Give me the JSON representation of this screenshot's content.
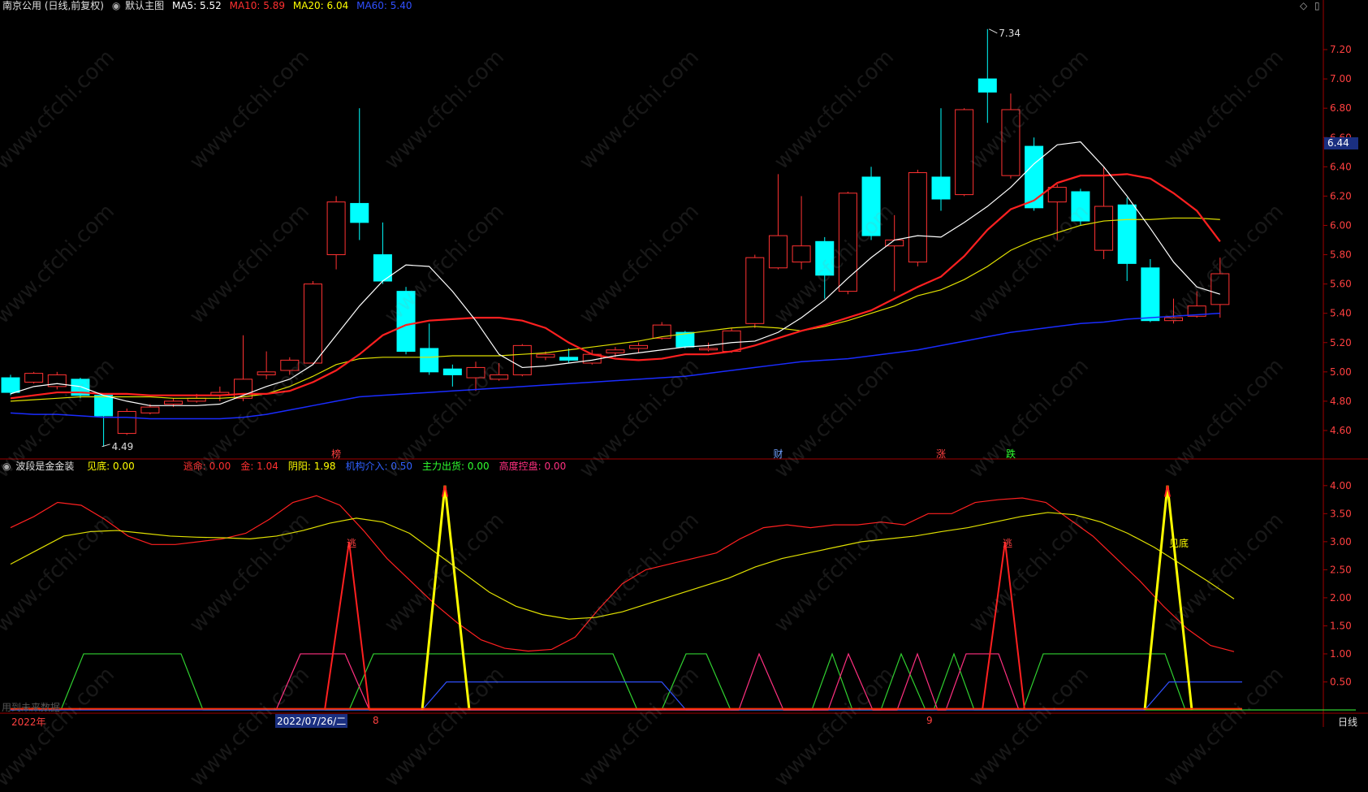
{
  "main_header": {
    "title": "南京公用 (日线,前复权)",
    "template": "默认主图",
    "ma5": "MA5: 5.52",
    "ma10": "MA10: 5.89",
    "ma20": "MA20: 6.04",
    "ma60": "MA60: 5.40"
  },
  "sub_header": {
    "title": "波段是金金装",
    "items": [
      {
        "text": "见底: 0.00",
        "color": "#ffff00"
      },
      {
        "text": "逃命: 0.00",
        "color": "#ff3030"
      },
      {
        "text": "金: 1.04",
        "color": "#ff3030"
      },
      {
        "text": "阴阳: 1.98",
        "color": "#ffff00"
      },
      {
        "text": "机构介入: 0.50",
        "color": "#3060ff"
      },
      {
        "text": "主力出货: 0.00",
        "color": "#30ff30"
      },
      {
        "text": "高度控盘: 0.00",
        "color": "#ff3080"
      }
    ]
  },
  "price_axis": [
    "7.20",
    "7.00",
    "6.80",
    "6.60",
    "6.40",
    "6.20",
    "6.00",
    "5.80",
    "5.60",
    "5.40",
    "5.20",
    "5.00",
    "4.80",
    "4.60"
  ],
  "current_price": "6.44",
  "high_label": "7.34",
  "low_label": "4.49",
  "event_markers": [
    "榜",
    "财",
    "涨",
    "跌"
  ],
  "sub_axis": [
    "4.00",
    "3.50",
    "3.00",
    "2.50",
    "2.00",
    "1.50",
    "1.00",
    "0.50"
  ],
  "sub_annotations": {
    "escape": "逃",
    "bottom": "见底"
  },
  "date_bar": {
    "year": "2022年",
    "cursor_date": "2022/07/26/二",
    "month8": "8",
    "month9": "9",
    "period": "日线"
  },
  "watermark": "www.cfchi.com",
  "footer_note": "用到未来数据",
  "colors": {
    "bg": "#000000",
    "up": "#ff3232",
    "down": "#00ffff",
    "ma5": "#ffffff",
    "ma10": "#ff2020",
    "ma20": "#e0e000",
    "ma60": "#1a2cff",
    "axis": "#a00000"
  },
  "chart_data": {
    "type": "candlestick",
    "ylim": [
      4.5,
      7.35
    ],
    "candles": [
      [
        4.96,
        4.86,
        4.98,
        4.84
      ],
      [
        4.93,
        4.99,
        5.0,
        4.92
      ],
      [
        4.9,
        4.98,
        5.0,
        4.88
      ],
      [
        4.95,
        4.84,
        4.96,
        4.82
      ],
      [
        4.84,
        4.7,
        4.85,
        4.49
      ],
      [
        4.58,
        4.73,
        4.75,
        4.57
      ],
      [
        4.72,
        4.76,
        4.78,
        4.71
      ],
      [
        4.78,
        4.8,
        4.82,
        4.76
      ],
      [
        4.8,
        4.82,
        4.85,
        4.79
      ],
      [
        4.84,
        4.86,
        4.9,
        4.8
      ],
      [
        4.82,
        4.95,
        5.25,
        4.8
      ],
      [
        4.98,
        5.0,
        5.14,
        4.95
      ],
      [
        5.01,
        5.08,
        5.1,
        4.98
      ],
      [
        5.06,
        5.6,
        5.62,
        5.05
      ],
      [
        5.8,
        6.16,
        6.2,
        5.7
      ],
      [
        6.15,
        6.02,
        6.8,
        5.9
      ],
      [
        5.8,
        5.62,
        6.02,
        5.6
      ],
      [
        5.55,
        5.14,
        5.58,
        5.12
      ],
      [
        5.16,
        5.0,
        5.33,
        4.98
      ],
      [
        5.02,
        4.98,
        5.05,
        4.9
      ],
      [
        4.96,
        5.03,
        5.07,
        4.87
      ],
      [
        4.95,
        4.98,
        5.06,
        4.94
      ],
      [
        4.98,
        5.18,
        5.19,
        4.97
      ],
      [
        5.1,
        5.12,
        5.14,
        5.08
      ],
      [
        5.1,
        5.08,
        5.16,
        5.06
      ],
      [
        5.06,
        5.12,
        5.15,
        5.05
      ],
      [
        5.13,
        5.15,
        5.17,
        5.1
      ],
      [
        5.16,
        5.18,
        5.2,
        5.13
      ],
      [
        5.23,
        5.32,
        5.34,
        5.22
      ],
      [
        5.27,
        5.17,
        5.28,
        5.16
      ],
      [
        5.15,
        5.16,
        5.2,
        5.14
      ],
      [
        5.14,
        5.28,
        5.3,
        5.13
      ],
      [
        5.33,
        5.78,
        5.8,
        5.3
      ],
      [
        5.71,
        5.93,
        6.35,
        5.7
      ],
      [
        5.75,
        5.86,
        6.2,
        5.7
      ],
      [
        5.89,
        5.66,
        5.92,
        5.5
      ],
      [
        5.55,
        6.22,
        6.23,
        5.53
      ],
      [
        6.33,
        5.93,
        6.4,
        5.9
      ],
      [
        5.86,
        5.9,
        6.07,
        5.55
      ],
      [
        5.75,
        6.36,
        6.38,
        5.72
      ],
      [
        6.33,
        6.18,
        6.8,
        6.1
      ],
      [
        6.21,
        6.79,
        6.8,
        6.2
      ],
      [
        7.0,
        6.91,
        7.34,
        6.7
      ],
      [
        6.34,
        6.79,
        6.9,
        6.32
      ],
      [
        6.54,
        6.12,
        6.6,
        6.1
      ],
      [
        6.16,
        6.26,
        6.28,
        5.9
      ],
      [
        6.23,
        6.03,
        6.25,
        6.0
      ],
      [
        5.83,
        6.13,
        6.4,
        5.77
      ],
      [
        6.14,
        5.74,
        6.19,
        5.62
      ],
      [
        5.71,
        5.35,
        5.77,
        5.34
      ],
      [
        5.35,
        5.37,
        5.5,
        5.33
      ],
      [
        5.38,
        5.45,
        5.55,
        5.37
      ],
      [
        5.46,
        5.67,
        5.78,
        5.37
      ]
    ],
    "ma5": [
      4.85,
      4.9,
      4.92,
      4.9,
      4.84,
      4.8,
      4.77,
      4.77,
      4.77,
      4.78,
      4.84,
      4.9,
      4.95,
      5.05,
      5.25,
      5.45,
      5.62,
      5.73,
      5.72,
      5.55,
      5.35,
      5.12,
      5.03,
      5.04,
      5.06,
      5.08,
      5.11,
      5.13,
      5.15,
      5.17,
      5.18,
      5.2,
      5.21,
      5.27,
      5.37,
      5.49,
      5.64,
      5.78,
      5.9,
      5.93,
      5.92,
      6.02,
      6.13,
      6.26,
      6.42,
      6.55,
      6.57,
      6.4,
      6.2,
      5.98,
      5.75,
      5.58,
      5.53
    ],
    "ma10": [
      4.82,
      4.84,
      4.86,
      4.86,
      4.85,
      4.85,
      4.84,
      4.84,
      4.84,
      4.84,
      4.85,
      4.85,
      4.87,
      4.93,
      5.01,
      5.12,
      5.25,
      5.32,
      5.35,
      5.36,
      5.37,
      5.37,
      5.35,
      5.3,
      5.2,
      5.12,
      5.09,
      5.08,
      5.09,
      5.12,
      5.12,
      5.14,
      5.18,
      5.23,
      5.28,
      5.32,
      5.37,
      5.42,
      5.5,
      5.58,
      5.65,
      5.79,
      5.97,
      6.11,
      6.17,
      6.29,
      6.34,
      6.34,
      6.35,
      6.32,
      6.22,
      6.1,
      5.89
    ],
    "ma20": [
      4.8,
      4.81,
      4.82,
      4.83,
      4.83,
      4.83,
      4.83,
      4.82,
      4.82,
      4.82,
      4.83,
      4.85,
      4.9,
      4.97,
      5.05,
      5.09,
      5.1,
      5.1,
      5.1,
      5.11,
      5.11,
      5.11,
      5.12,
      5.13,
      5.15,
      5.17,
      5.19,
      5.21,
      5.24,
      5.26,
      5.28,
      5.3,
      5.31,
      5.3,
      5.28,
      5.31,
      5.35,
      5.4,
      5.45,
      5.52,
      5.56,
      5.63,
      5.72,
      5.83,
      5.9,
      5.95,
      6.0,
      6.03,
      6.04,
      6.04,
      6.05,
      6.05,
      6.04
    ],
    "ma60": [
      4.72,
      4.71,
      4.71,
      4.7,
      4.69,
      4.69,
      4.68,
      4.68,
      4.68,
      4.68,
      4.69,
      4.71,
      4.74,
      4.77,
      4.8,
      4.83,
      4.84,
      4.85,
      4.86,
      4.87,
      4.88,
      4.89,
      4.9,
      4.91,
      4.92,
      4.93,
      4.94,
      4.95,
      4.96,
      4.97,
      4.99,
      5.01,
      5.03,
      5.05,
      5.07,
      5.08,
      5.09,
      5.11,
      5.13,
      5.15,
      5.18,
      5.21,
      5.24,
      5.27,
      5.29,
      5.31,
      5.33,
      5.34,
      5.36,
      5.37,
      5.38,
      5.39,
      5.4
    ],
    "sub_ylim": [
      0,
      4.2
    ],
    "sub_gold": [
      3.25,
      3.45,
      3.7,
      3.65,
      3.4,
      3.1,
      2.95,
      2.95,
      3.0,
      3.05,
      3.15,
      3.4,
      3.7,
      3.82,
      3.65,
      3.2,
      2.7,
      2.3,
      1.9,
      1.55,
      1.25,
      1.1,
      1.05,
      1.08,
      1.3,
      1.8,
      2.25,
      2.5,
      2.6,
      2.7,
      2.8,
      3.05,
      3.25,
      3.3,
      3.25,
      3.3,
      3.3,
      3.35,
      3.3,
      3.5,
      3.5,
      3.7,
      3.75,
      3.78,
      3.7,
      3.4,
      3.1,
      2.7,
      2.3,
      1.85,
      1.45,
      1.15,
      1.04
    ],
    "sub_yinyang": [
      2.6,
      2.85,
      3.1,
      3.18,
      3.2,
      3.15,
      3.1,
      3.08,
      3.07,
      3.05,
      3.1,
      3.2,
      3.33,
      3.42,
      3.35,
      3.15,
      2.8,
      2.45,
      2.1,
      1.85,
      1.7,
      1.62,
      1.65,
      1.75,
      1.9,
      2.05,
      2.2,
      2.35,
      2.55,
      2.7,
      2.8,
      2.9,
      3.0,
      3.05,
      3.1,
      3.18,
      3.25,
      3.35,
      3.45,
      3.52,
      3.48,
      3.35,
      3.15,
      2.9,
      2.6,
      2.3,
      1.98
    ],
    "sub_bottom_peaks": [
      18,
      48
    ],
    "sub_escape_peaks": [
      14,
      41
    ]
  }
}
